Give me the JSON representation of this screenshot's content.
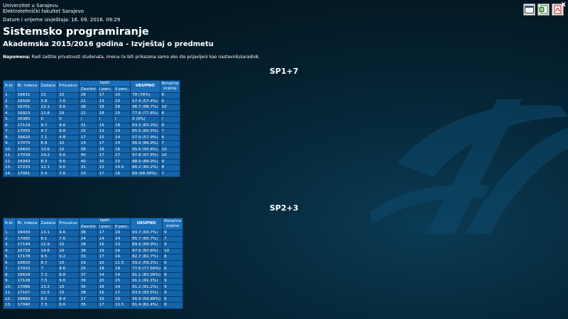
{
  "header": {
    "institution_line1": "Univerzitet u Sarajevu",
    "institution_line2": "Elektrotehnički fakultet Sarajevo",
    "datetime": "Datum i vrijeme izvještaja: 16. 09. 2016. 09:29"
  },
  "toolbar": {
    "close_label": "x",
    "icons": [
      "window-icon",
      "excel-icon",
      "pdf-icon"
    ]
  },
  "title": "Sistemsko programiranje",
  "subtitle": "Akademska 2015/2016 godina - Izvještaj o predmetu",
  "note": {
    "label": "Napomena:",
    "text": " Radi zaštite privatnosti studenata, imena će biti prikazana samo ako ste prijavljeni kao nastavnik/saradnik."
  },
  "columns": {
    "rbr": "R.br.",
    "index": "Br. indexa",
    "zadace": "Zadaće",
    "prisustvo": "Prisustvo",
    "ispiti": "Ispiti",
    "zavrsni": "Završni",
    "iparc": "I parc.",
    "iiparc": "II parc.",
    "ukupno": "UKUPNO",
    "konacna1": "Konačna",
    "konacna2": "ocjena"
  },
  "sections": [
    {
      "title": "SP1+7",
      "rows": [
        [
          "1.",
          "16631",
          "13",
          "10",
          "28",
          "17",
          "10",
          "78 (78%)",
          "8"
        ],
        [
          "2.",
          "16500",
          "5.8",
          "7.6",
          "21",
          "13",
          "10",
          "57.4 (57.4%)",
          "6"
        ],
        [
          "3.",
          "16701",
          "13.1",
          "9.6",
          "38",
          "18",
          "18",
          "96.7 (96.7%)",
          "10"
        ],
        [
          "4.",
          "16923",
          "12.8",
          "10",
          "22",
          "18",
          "15",
          "77.8 (77.8%)",
          "8"
        ],
        [
          "5.",
          "16385",
          "0",
          "0",
          "/",
          "/",
          "/",
          "0 (0%)",
          "/"
        ],
        [
          "6.",
          "17119",
          "9.7",
          "9.6",
          "31",
          "15",
          "18",
          "83.3 (83.3%)",
          "8"
        ],
        [
          "7.",
          "17055",
          "4.7",
          "8.8",
          "25",
          "13",
          "14",
          "65.5 (65.5%)",
          "7"
        ],
        [
          "8.",
          "16620",
          "7.1",
          "4.8",
          "17",
          "15",
          "14",
          "57.9 (57.9%)",
          "6"
        ],
        [
          "9.",
          "17075",
          "6.9",
          "10",
          "19",
          "17",
          "14",
          "66.9 (66.9%)",
          "7"
        ],
        [
          "10.",
          "16650",
          "13.6",
          "10",
          "38",
          "18",
          "16",
          "95.6 (95.6%)",
          "10"
        ],
        [
          "11.",
          "17039",
          "14.2",
          "9.6",
          "40",
          "17",
          "17",
          "97.8 (97.8%)",
          "10"
        ],
        [
          "12.",
          "16993",
          "8.3",
          "9.6",
          "40",
          "16",
          "15",
          "88.9 (88.9%)",
          "9"
        ],
        [
          "13.",
          "17225",
          "12.1",
          "9.6",
          "31",
          "13",
          "14.5",
          "80.2 (80.2%)",
          "8"
        ],
        [
          "14.",
          "17061",
          "5.4",
          "7.6",
          "23",
          "17",
          "16",
          "69 (68.99%)",
          "7"
        ]
      ]
    },
    {
      "title": "SP2+3",
      "rows": [
        [
          "1.",
          "16430",
          "13.1",
          "9.6",
          "38",
          "17",
          "16",
          "93.7 (93.7%)",
          "9"
        ],
        [
          "2.",
          "17065",
          "6.1",
          "7.6",
          "24",
          "14",
          "14",
          "65.7 (65.7%)",
          "7"
        ],
        [
          "3.",
          "17149",
          "12.9",
          "10",
          "38",
          "16",
          "13",
          "89.9 (89.9%)",
          "9"
        ],
        [
          "4.",
          "16728",
          "14.6",
          "10",
          "38",
          "19",
          "16",
          "97.6 (97.6%)",
          "10"
        ],
        [
          "5.",
          "17178",
          "9.5",
          "9.2",
          "33",
          "17",
          "14",
          "82.7 (82.7%)",
          "8"
        ],
        [
          "6.",
          "16810",
          "8.7",
          "10",
          "19",
          "10",
          "11.5",
          "59.2 (59.2%)",
          "6"
        ],
        [
          "7.",
          "17015",
          "7",
          "9.6",
          "25",
          "18",
          "18",
          "77.6 (77.59%)",
          "8"
        ],
        [
          "8.",
          "16629",
          "7.3",
          "8.8",
          "37",
          "14",
          "14",
          "81.1 (81.09%)",
          "8"
        ],
        [
          "9.",
          "17126",
          "7.5",
          "9.6",
          "39",
          "20",
          "15",
          "91.1 (91.1%)",
          "9"
        ],
        [
          "10.",
          "17096",
          "13.2",
          "10",
          "36",
          "18",
          "14",
          "91.2 (91.2%)",
          "9"
        ],
        [
          "11.",
          "17107",
          "12.5",
          "10",
          "38",
          "16",
          "17",
          "93.5 (93.5%)",
          "9"
        ],
        [
          "12.",
          "16660",
          "6.5",
          "8.4",
          "17",
          "15",
          "10",
          "56.9 (56.89%)",
          "6"
        ],
        [
          "13.",
          "17040",
          "7.3",
          "9.6",
          "35",
          "17",
          "12.5",
          "81.4 (81.4%)",
          "8"
        ]
      ]
    }
  ]
}
